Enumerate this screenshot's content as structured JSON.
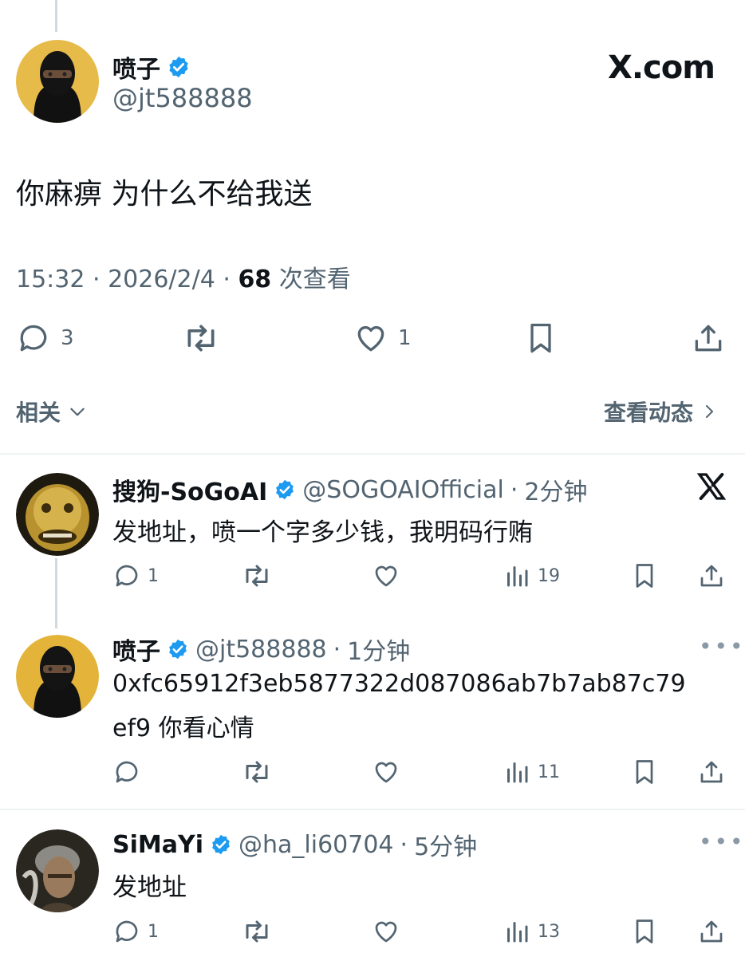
{
  "main_tweet": {
    "author_name": "喷子",
    "handle": "@jt588888",
    "brand": "X.com",
    "text": "你麻痹 为什么不给我送",
    "time": "15:32",
    "date": "2026/2/4",
    "separator": " · ",
    "views_count": "68",
    "views_label": " 次查看",
    "replies": "3",
    "likes": "1"
  },
  "section": {
    "related_label": "相关",
    "view_activity_label": "查看动态"
  },
  "replies": [
    {
      "name": "搜狗-SoGoAI",
      "handle": "@SOGOAIOfficial",
      "time": "2分钟",
      "text": "发地址，喷一个字多少钱，我明码行贿",
      "replies": "1",
      "views": "19",
      "badge_icon": "x-logo-icon"
    },
    {
      "name": "喷子",
      "handle": "@jt588888",
      "time": "1分钟",
      "text_line1": "0xfc65912f3eb5877322d087086ab7b7ab87c79",
      "text_line2": "ef9  你看心情",
      "views": "11"
    },
    {
      "name": "SiMaYi",
      "handle": "@ha_li60704",
      "time": "5分钟",
      "text": "发地址",
      "replies": "1",
      "views": "13"
    }
  ],
  "colors": {
    "verified": "#1d9bf0",
    "muted": "#536471",
    "divider": "#eff3f4"
  }
}
